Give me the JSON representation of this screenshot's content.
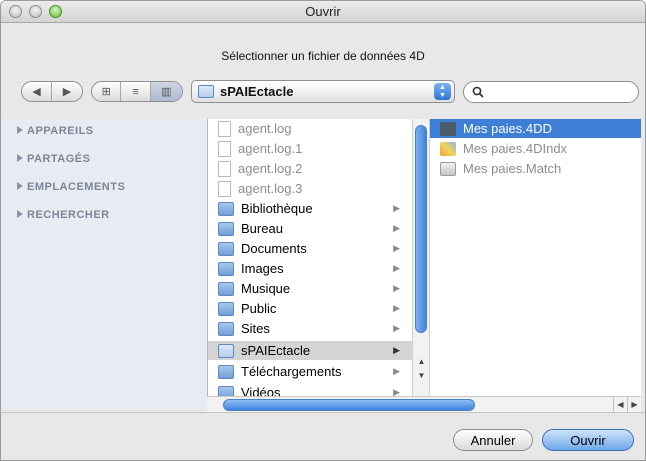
{
  "window": {
    "title": "Ouvrir"
  },
  "prompt": "Sélectionner un fichier de données 4D",
  "toolbar": {
    "back_icon": "◀",
    "forward_icon": "▶",
    "view_icons": [
      "⊞",
      "≡",
      "▥"
    ],
    "location": "sPAIEctacle",
    "location_icon": "folder-icon",
    "search_icon": "🔍"
  },
  "sidebar": {
    "items": [
      {
        "label": "APPAREILS"
      },
      {
        "label": "PARTAGÉS"
      },
      {
        "label": "EMPLACEMENTS"
      },
      {
        "label": "RECHERCHER"
      }
    ]
  },
  "column1": {
    "items": [
      {
        "label": "agent.log",
        "icon": "doc",
        "dim": true
      },
      {
        "label": "agent.log.1",
        "icon": "doc",
        "dim": true
      },
      {
        "label": "agent.log.2",
        "icon": "doc",
        "dim": true
      },
      {
        "label": "agent.log.3",
        "icon": "doc",
        "dim": true
      },
      {
        "label": "Bibliothèque",
        "icon": "folder",
        "arrow": true
      },
      {
        "label": "Bureau",
        "icon": "folder",
        "arrow": true
      },
      {
        "label": "Documents",
        "icon": "folder",
        "arrow": true
      },
      {
        "label": "Images",
        "icon": "folder",
        "arrow": true
      },
      {
        "label": "Musique",
        "icon": "folder",
        "arrow": true
      },
      {
        "label": "Public",
        "icon": "folder",
        "arrow": true
      },
      {
        "label": "Sites",
        "icon": "folder",
        "arrow": true
      },
      {
        "label": "sPAIEctacle",
        "icon": "folder-plain",
        "arrow": true,
        "selected": true
      },
      {
        "label": "Téléchargements",
        "icon": "folder",
        "arrow": true
      },
      {
        "label": "Vidéos",
        "icon": "folder",
        "arrow": true
      }
    ]
  },
  "column2": {
    "items": [
      {
        "label": "Mes paies.4DD",
        "icon": "filedark",
        "selected": true
      },
      {
        "label": "Mes paies.4DIndx",
        "icon": "filemulti",
        "dim": true
      },
      {
        "label": "Mes paies.Match",
        "icon": "filelist",
        "dim": true
      }
    ]
  },
  "buttons": {
    "cancel": "Annuler",
    "open": "Ouvrir"
  }
}
